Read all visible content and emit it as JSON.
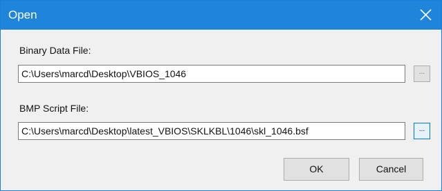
{
  "window": {
    "title": "Open",
    "close_icon": "close-icon"
  },
  "binary_data": {
    "label": "Binary Data File:",
    "value": "C:\\Users\\marcd\\Desktop\\VBIOS_1046",
    "browse_label": "..."
  },
  "bmp_script": {
    "label": "BMP Script File:",
    "value": "C:\\Users\\marcd\\Desktop\\latest_VBIOS\\SKLKBL\\1046\\skl_1046.bsf",
    "browse_label": "..."
  },
  "buttons": {
    "ok_label": "OK",
    "cancel_label": "Cancel"
  },
  "colors": {
    "titlebar": "#1f85da",
    "dialog_bg": "#f0f0f0",
    "focus_accent": "#0078d7"
  }
}
